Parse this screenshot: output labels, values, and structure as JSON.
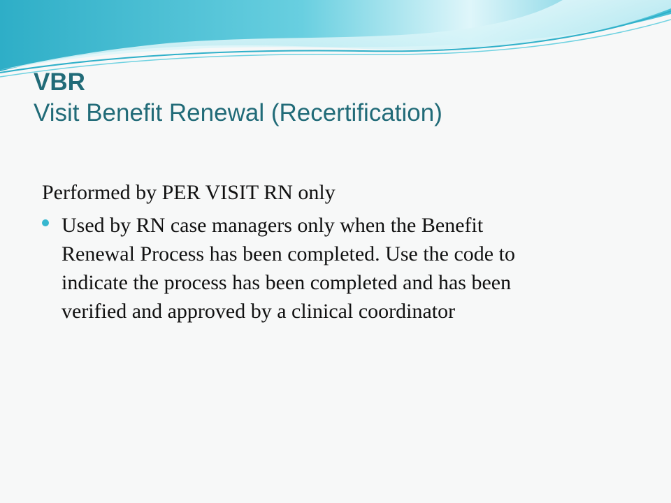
{
  "slide": {
    "title": "VBR",
    "subtitle": "Visit Benefit Renewal  (Recertification)",
    "lead": "Performed by  PER VISIT RN only",
    "bullet": "Used by RN case managers only when the Benefit\nRenewal Process has been completed.  Use the code to\nindicate the process has been completed and has been\nverified and approved by a clinical coordinator"
  },
  "colors": {
    "title": "#216b78",
    "bullet": "#37b7cf",
    "wave_primary": "#2fb0c9",
    "wave_light": "#8fdbe8",
    "background": "#f7f8f8"
  }
}
